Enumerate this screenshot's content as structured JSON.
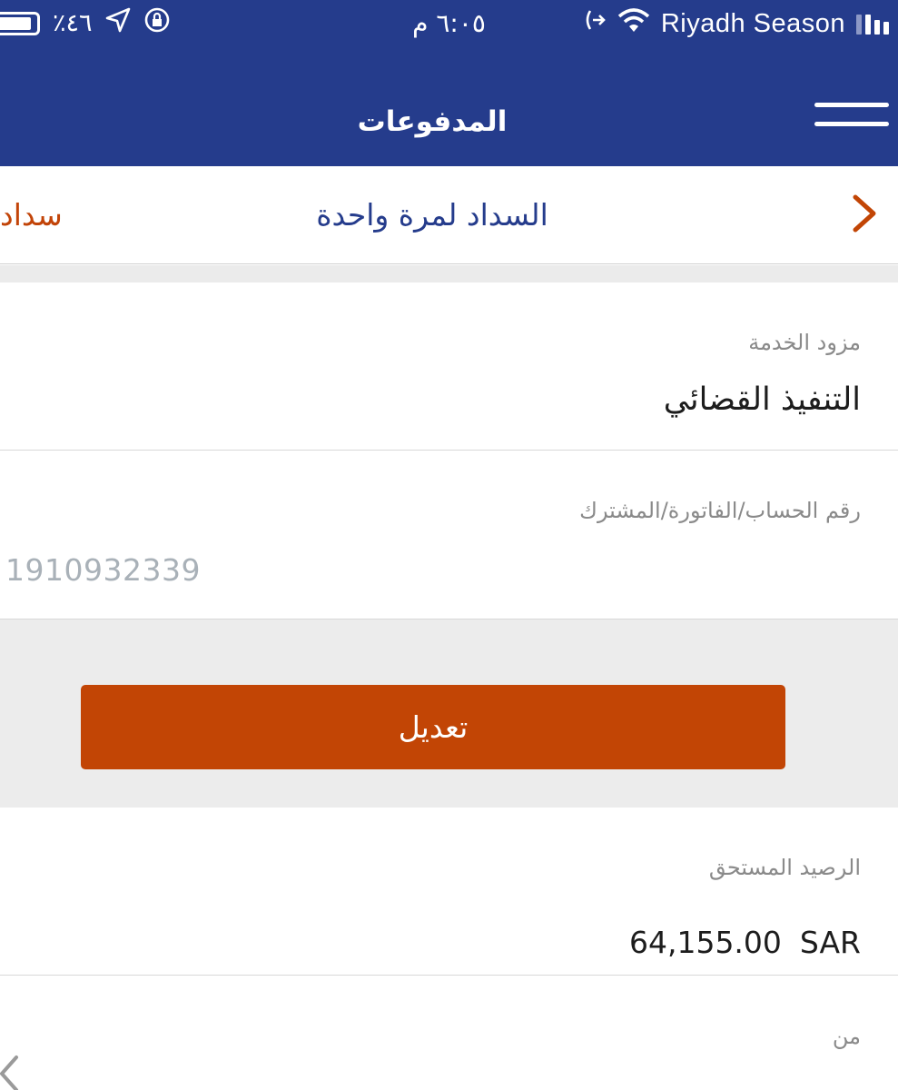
{
  "status_bar": {
    "battery_percent": "٪٤٦",
    "time": "٦:٠٥ م",
    "carrier": "Riyadh Season",
    "icons": [
      "battery-icon",
      "location-arrow-icon",
      "orientation-lock-icon",
      "call-forward-icon",
      "wifi-icon",
      "signal-icon"
    ]
  },
  "header": {
    "title": "المدفوعات",
    "menu_icon": "hamburger-menu-icon"
  },
  "tabs": {
    "active_label": "السداد لمرة واحدة",
    "partial_label": "سداد",
    "next_icon": "chevron-right-icon"
  },
  "form": {
    "provider": {
      "label": "مزود الخدمة",
      "value": "التنفيذ القضائي"
    },
    "account": {
      "label": "رقم الحساب/الفاتورة/المشترك",
      "value": "1910932339"
    },
    "edit_button": "تعديل",
    "balance": {
      "label": "الرصيد المستحق",
      "amount": "64,155.00",
      "currency": "SAR"
    },
    "from": {
      "label": "من"
    }
  },
  "colors": {
    "header_bg": "#253c8c",
    "accent_orange": "#c24505",
    "tab_text": "#253c8c"
  }
}
